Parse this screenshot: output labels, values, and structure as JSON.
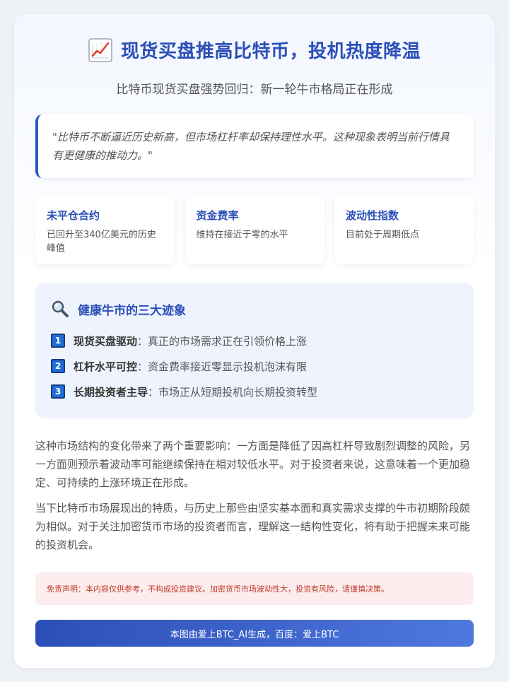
{
  "header": {
    "title": "现货买盘推高比特币，投机热度降温",
    "title_icon": "chart-increasing-icon",
    "subtitle": "比特币现货买盘强势回归：新一轮牛市格局正在形成"
  },
  "quote": {
    "text": "\"比特币不断逼近历史新高，但市场杠杆率却保持理性水平。这种现象表明当前行情具有更健康的推动力。\""
  },
  "stats": [
    {
      "title": "未平仓合约",
      "desc": "已回升至340亿美元的历史峰值"
    },
    {
      "title": "资金费率",
      "desc": "维持在接近于零的水平"
    },
    {
      "title": "波动性指数",
      "desc": "目前处于周期低点"
    }
  ],
  "signs": {
    "icon": "magnifying-glass-icon",
    "title": "健康牛市的三大迹象",
    "items": [
      {
        "num": "1",
        "label": "现货买盘驱动",
        "text": "：真正的市场需求正在引领价格上涨"
      },
      {
        "num": "2",
        "label": "杠杆水平可控",
        "text": "：资金费率接近零显示投机泡沫有限"
      },
      {
        "num": "3",
        "label": "长期投资者主导",
        "text": "：市场正从短期投机向长期投资转型"
      }
    ]
  },
  "paragraphs": [
    "这种市场结构的变化带来了两个重要影响：一方面是降低了因高杠杆导致剧烈调整的风险，另一方面则预示着波动率可能继续保持在相对较低水平。对于投资者来说，这意味着一个更加稳定、可持续的上涨环境正在形成。",
    "当下比特币市场展现出的特质，与历史上那些由坚实基本面和真实需求支撑的牛市初期阶段颇为相似。对于关注加密货币市场的投资者而言，理解这一结构性变化，将有助于把握未来可能的投资机会。"
  ],
  "disclaimer": "免责声明：本内容仅供参考，不构成投资建议。加密货币市场波动性大，投资有风险，请谨慎决策。",
  "footer": "本图由爱上BTC_AI生成，百度：爱上BTC",
  "colors": {
    "accent": "#2b4fb8",
    "disclaimer_text": "#c0392b",
    "badge": "#1f6fd6"
  }
}
